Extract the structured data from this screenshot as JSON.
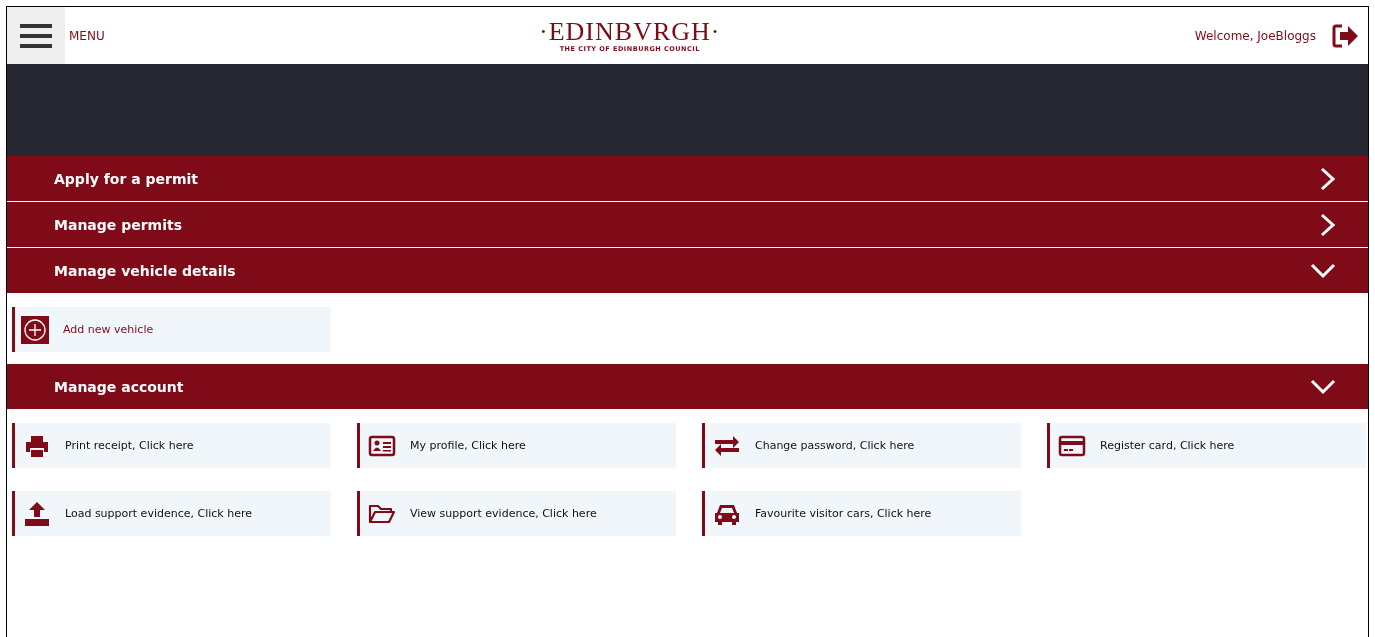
{
  "header": {
    "menu_label": "MENU",
    "logo_title": "·EDINBVRGH·",
    "logo_subtitle": "THE CITY OF EDINBURGH COUNCIL",
    "welcome": "Welcome, JoeBloggs"
  },
  "sections": [
    {
      "title": "Apply for a permit",
      "expanded": false
    },
    {
      "title": "Manage permits",
      "expanded": false
    },
    {
      "title": "Manage vehicle details",
      "expanded": true,
      "items": [
        {
          "kind": "add",
          "label": "Add new vehicle"
        }
      ]
    },
    {
      "title": "Manage account",
      "expanded": true,
      "items": [
        {
          "kind": "printer",
          "label": "Print receipt, Click here"
        },
        {
          "kind": "profile",
          "label": "My profile, Click here"
        },
        {
          "kind": "swap",
          "label": "Change password, Click here"
        },
        {
          "kind": "card",
          "label": "Register card, Click here"
        },
        {
          "kind": "upload",
          "label": "Load support evidence, Click here"
        },
        {
          "kind": "folder",
          "label": "View support evidence, Click here"
        },
        {
          "kind": "car",
          "label": "Favourite visitor cars, Click here"
        }
      ]
    }
  ]
}
